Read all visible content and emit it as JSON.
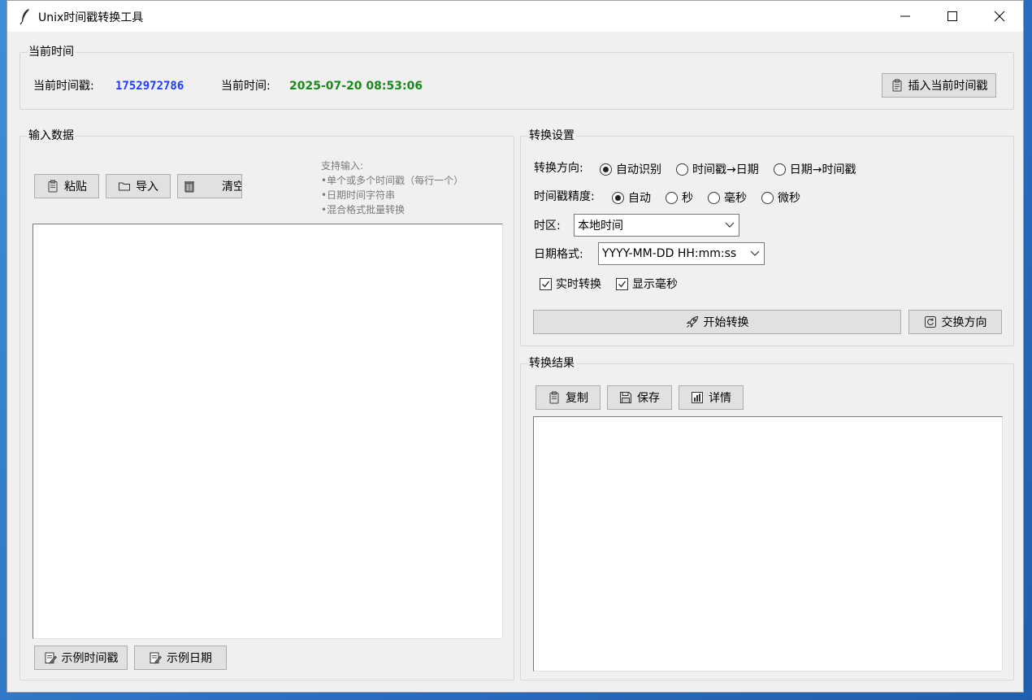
{
  "window": {
    "title": "Unix时间戳转换工具"
  },
  "current_time": {
    "group_title": "当前时间",
    "timestamp_label": "当前时间戳:",
    "timestamp_value": "1752972786",
    "time_label": "当前时间:",
    "time_value": "2025-07-20 08:53:06",
    "insert_button": "插入当前时间戳"
  },
  "input": {
    "group_title": "输入数据",
    "paste_button": "粘贴",
    "import_button": "导入",
    "clear_button": "清空",
    "help_lines": [
      "支持输入:",
      "•单个或多个时间戳（每行一个）",
      "•日期时间字符串",
      "•混合格式批量转换"
    ],
    "text_value": "",
    "example_timestamp_button": "示例时间戳",
    "example_date_button": "示例日期"
  },
  "settings": {
    "group_title": "转换设置",
    "direction_label": "转换方向:",
    "direction_options": [
      "自动识别",
      "时间戳→日期",
      "日期→时间戳"
    ],
    "direction_selected": 0,
    "precision_label": "时间戳精度:",
    "precision_options": [
      "自动",
      "秒",
      "毫秒",
      "微秒"
    ],
    "precision_selected": 0,
    "timezone_label": "时区:",
    "timezone_value": "本地时间",
    "format_label": "日期格式:",
    "format_value": "YYYY-MM-DD HH:mm:ss",
    "realtime_label": "实时转换",
    "realtime_checked": true,
    "show_ms_label": "显示毫秒",
    "show_ms_checked": true,
    "start_button": "开始转换",
    "swap_button": "交换方向"
  },
  "result": {
    "group_title": "转换结果",
    "copy_button": "复制",
    "save_button": "保存",
    "details_button": "详情",
    "text_value": ""
  },
  "colors": {
    "timestamp": "#1f3cff",
    "time": "#1a8a1a"
  }
}
